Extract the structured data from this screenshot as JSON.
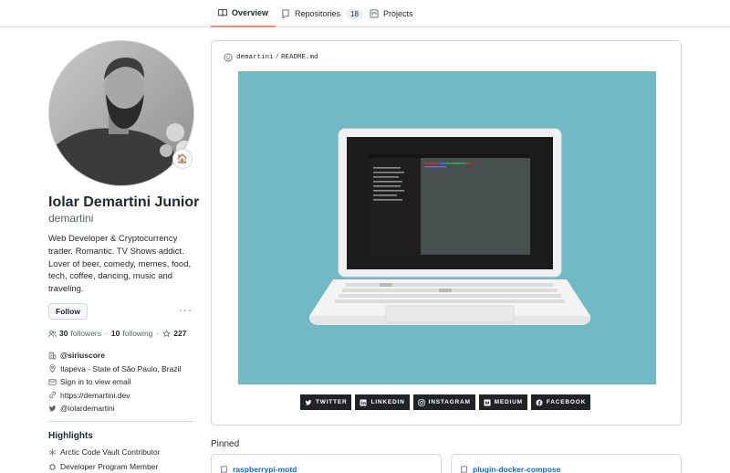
{
  "tabs": [
    {
      "label": "Overview",
      "icon": "book-icon",
      "active": true
    },
    {
      "label": "Repositories",
      "icon": "repo-icon",
      "count": "18"
    },
    {
      "label": "Projects",
      "icon": "project-icon"
    }
  ],
  "profile": {
    "name": "Iolar Demartini Junior",
    "login": "demartini",
    "bio": "Web Developer & Cryptocurrency trader. Romantic. TV Shows addict. Lover of beer, comedy, memes, food, tech, coffee, dancing, music and traveling.",
    "status_emoji": "🏠",
    "follow_label": "Follow",
    "more_label": "···",
    "followers_count": "30",
    "followers_label": "followers",
    "following_count": "10",
    "following_label": "following",
    "dot": "·",
    "stars_count": "227",
    "organization": "@siriuscore",
    "location": "Itapeva - State of São Paulo, Brazil",
    "email_text": "Sign in to view email",
    "website": "https://demartini.dev",
    "twitter": "@iolardemartini"
  },
  "highlights": {
    "title": "Highlights",
    "items": [
      "Arctic Code Vault Contributor",
      "Developer Program Member"
    ]
  },
  "readme": {
    "owner": "demartini",
    "separator": "/",
    "file": "README.md",
    "banner_color": "#70b9c5",
    "socials": [
      "TWITTER",
      "LINKEDIN",
      "INSTAGRAM",
      "MEDIUM",
      "FACEBOOK"
    ]
  },
  "pinned": {
    "title": "Pinned",
    "repos": [
      "raspberrypi-motd",
      "plugin-docker-compose"
    ]
  },
  "colors": {
    "accent_underline": "#fd8c73",
    "link": "#0969da",
    "text": "#24292f",
    "muted": "#57606a",
    "border": "#d0d7de"
  }
}
